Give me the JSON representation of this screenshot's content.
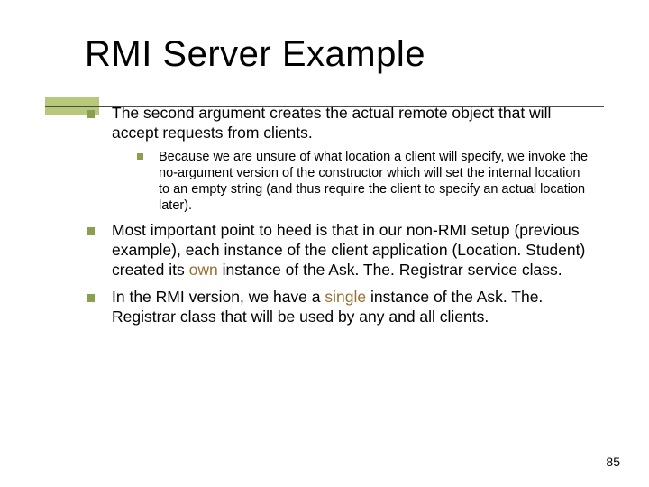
{
  "title": "RMI Server Example",
  "bullets": {
    "p1": "The second argument creates the actual remote object that will accept requests from clients.",
    "p1_sub": "Because we are unsure of what location a client will specify, we invoke the no-argument version of the constructor which will set the internal location to an empty string (and thus require the client to specify an actual location later).",
    "p2_a": "Most important point to heed is that in our non-RMI setup (previous example), each instance of the client application (Location. Student) created its ",
    "p2_hl": "own",
    "p2_b": " instance of the Ask. The. Registrar service class.",
    "p3_a": "In the RMI version, we have a ",
    "p3_hl": "single",
    "p3_b": " instance of the Ask. The. Registrar class that will be used by any and all clients."
  },
  "pagenum": "85"
}
